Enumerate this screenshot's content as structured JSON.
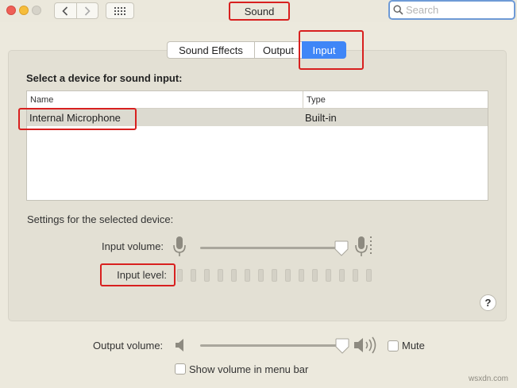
{
  "window": {
    "title": "Sound"
  },
  "search": {
    "placeholder": "Search",
    "value": ""
  },
  "tabs": [
    {
      "label": "Sound Effects",
      "active": false
    },
    {
      "label": "Output",
      "active": false
    },
    {
      "label": "Input",
      "active": true
    }
  ],
  "input": {
    "select_label": "Select a device for sound input:",
    "table": {
      "columns": [
        "Name",
        "Type"
      ],
      "rows": [
        {
          "name": "Internal Microphone",
          "type": "Built-in",
          "selected": true
        }
      ]
    },
    "settings_label": "Settings for the selected device:",
    "input_volume_label": "Input volume:",
    "input_volume_level": 0.97,
    "input_level_label": "Input level:",
    "input_level_segments_total": 15,
    "input_level_segments_lit": 0
  },
  "output": {
    "output_volume_label": "Output volume:",
    "output_volume_level": 0.98,
    "mute_label": "Mute",
    "mute_checked": false,
    "show_volume_label": "Show volume in menu bar",
    "show_volume_checked": false
  },
  "watermark": "wsxdn.com",
  "colors": {
    "accent": "#3f86f7",
    "annotation_red": "#d8201f",
    "window_bg": "#ece9dd"
  }
}
